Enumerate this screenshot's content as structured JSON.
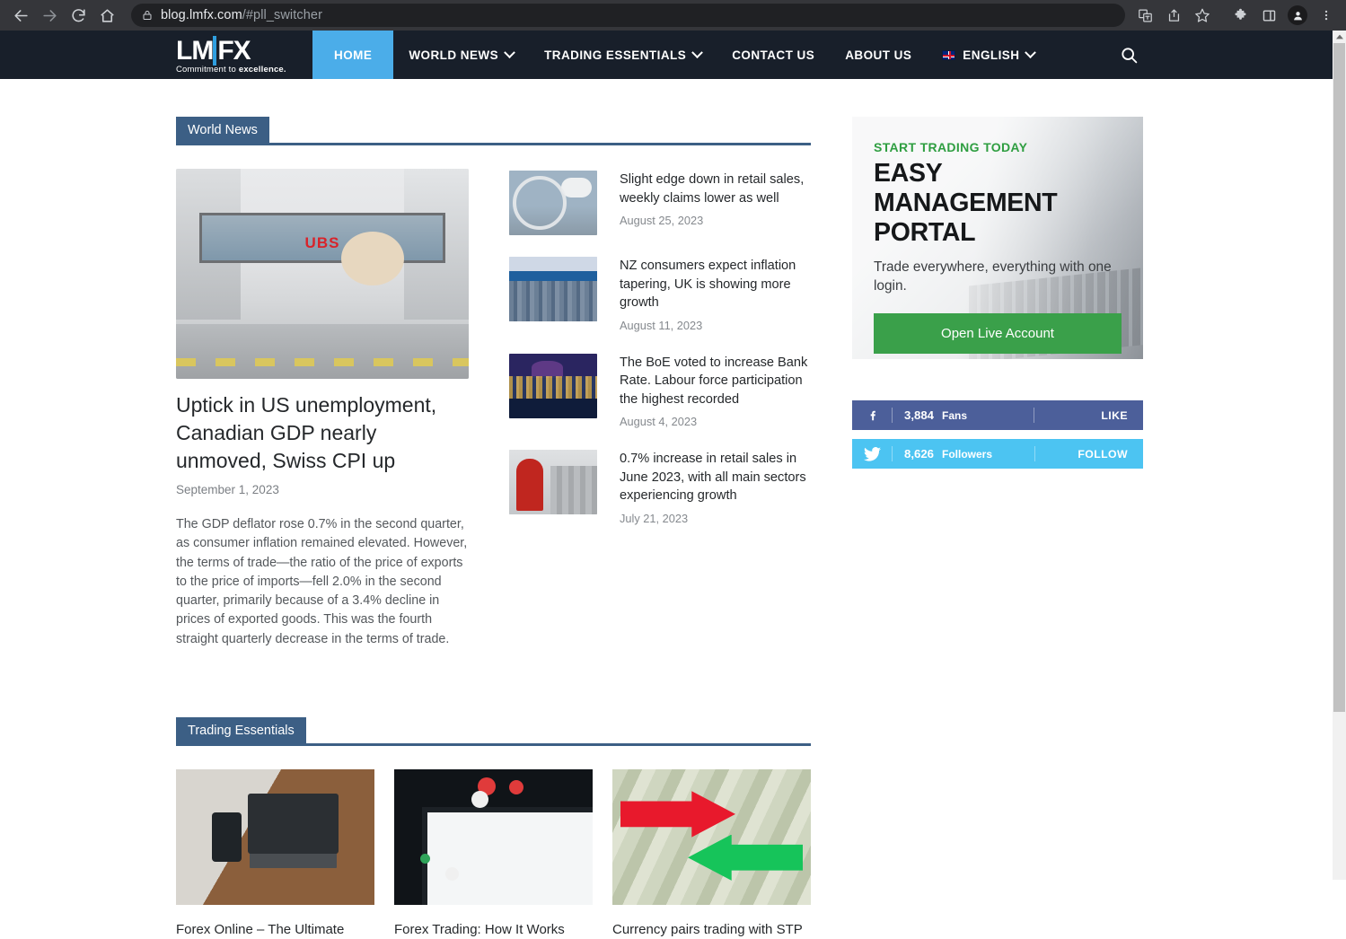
{
  "browser": {
    "url_main": "blog.lmfx.com",
    "url_fragment": "/#pll_switcher",
    "back_icon": "back-arrow-icon",
    "forward_icon": "forward-arrow-icon",
    "reload_icon": "reload-icon",
    "home_icon": "home-icon",
    "lock_icon": "lock-icon",
    "translate_icon": "translate-icon",
    "share_icon": "share-icon",
    "bookmark_icon": "star-icon",
    "extensions_icon": "puzzle-piece-icon",
    "sidepanel_icon": "side-panel-icon",
    "profile_icon": "profile-avatar-icon",
    "menu_icon": "three-dot-menu-icon"
  },
  "site": {
    "logo_text": "LMFX",
    "logo_tagline_light": "Commitment to ",
    "logo_tagline_bold": "excellence.",
    "menu": [
      {
        "label": "HOME",
        "active": true,
        "caret": false
      },
      {
        "label": "WORLD NEWS",
        "active": false,
        "caret": true
      },
      {
        "label": "TRADING ESSENTIALS",
        "active": false,
        "caret": true
      },
      {
        "label": "CONTACT US",
        "active": false,
        "caret": false
      },
      {
        "label": "ABOUT US",
        "active": false,
        "caret": false
      }
    ],
    "language": "ENGLISH",
    "search_icon": "search-icon",
    "nav_bg": "#181f2a",
    "active_bg": "#4bade9"
  },
  "world_news": {
    "section_label": "World News",
    "accent": "#3c5f85",
    "featured": {
      "title": "Uptick in US unemployment, Canadian GDP nearly unmoved, Swiss CPI up",
      "date": "September 1, 2023",
      "excerpt": "The GDP deflator rose 0.7% in the second quarter, as consumer inflation remained elevated. However, the terms of trade—the ratio of the price of exports to the price of imports—fell 2.0% in the second quarter, primarily because of a 3.4% decline in prices of exported goods. This was the fourth straight quarterly decrease in the terms of trade.",
      "image_alt": "swiss-street-ubs-photo"
    },
    "items": [
      {
        "title": "Slight edge down in retail sales, weekly claims lower as well",
        "date": "August 25, 2023",
        "image_alt": "ferris-wheel-photo"
      },
      {
        "title": "NZ consumers expect inflation tapering, UK is showing more growth",
        "date": "August 11, 2023",
        "image_alt": "city-skyline-photo"
      },
      {
        "title": "The BoE voted to increase Bank Rate. Labour force participation the highest recorded",
        "date": "August 4, 2023",
        "image_alt": "london-night-skyline-photo"
      },
      {
        "title": "0.7% increase in retail sales in June 2023, with all main sectors experiencing growth",
        "date": "July 21, 2023",
        "image_alt": "red-postbox-photo"
      }
    ]
  },
  "promo": {
    "kicker": "START TRADING TODAY",
    "title": "EASY MANAGEMENT PORTAL",
    "subtitle": "Trade everywhere, everything with one login.",
    "cta": "Open Live Account",
    "kicker_color": "#2f9e41",
    "cta_color": "#3aa04a"
  },
  "social": [
    {
      "network": "facebook",
      "icon": "facebook-icon",
      "count": "3,884",
      "label": "Fans",
      "action": "LIKE",
      "color": "#4c5f9a"
    },
    {
      "network": "twitter",
      "icon": "twitter-bird-icon",
      "count": "8,626",
      "label": "Followers",
      "action": "FOLLOW",
      "color": "#4cc4f2"
    }
  ],
  "trading_essentials": {
    "section_label": "Trading Essentials",
    "cards": [
      {
        "title": "Forex Online – The Ultimate",
        "image_alt": "man-with-laptop-and-phone-photo"
      },
      {
        "title": "Forex Trading: How It Works",
        "image_alt": "candlestick-chart-monitor-photo"
      },
      {
        "title": "Currency pairs trading with STP",
        "image_alt": "dollar-bills-with-arrows-photo"
      }
    ]
  }
}
